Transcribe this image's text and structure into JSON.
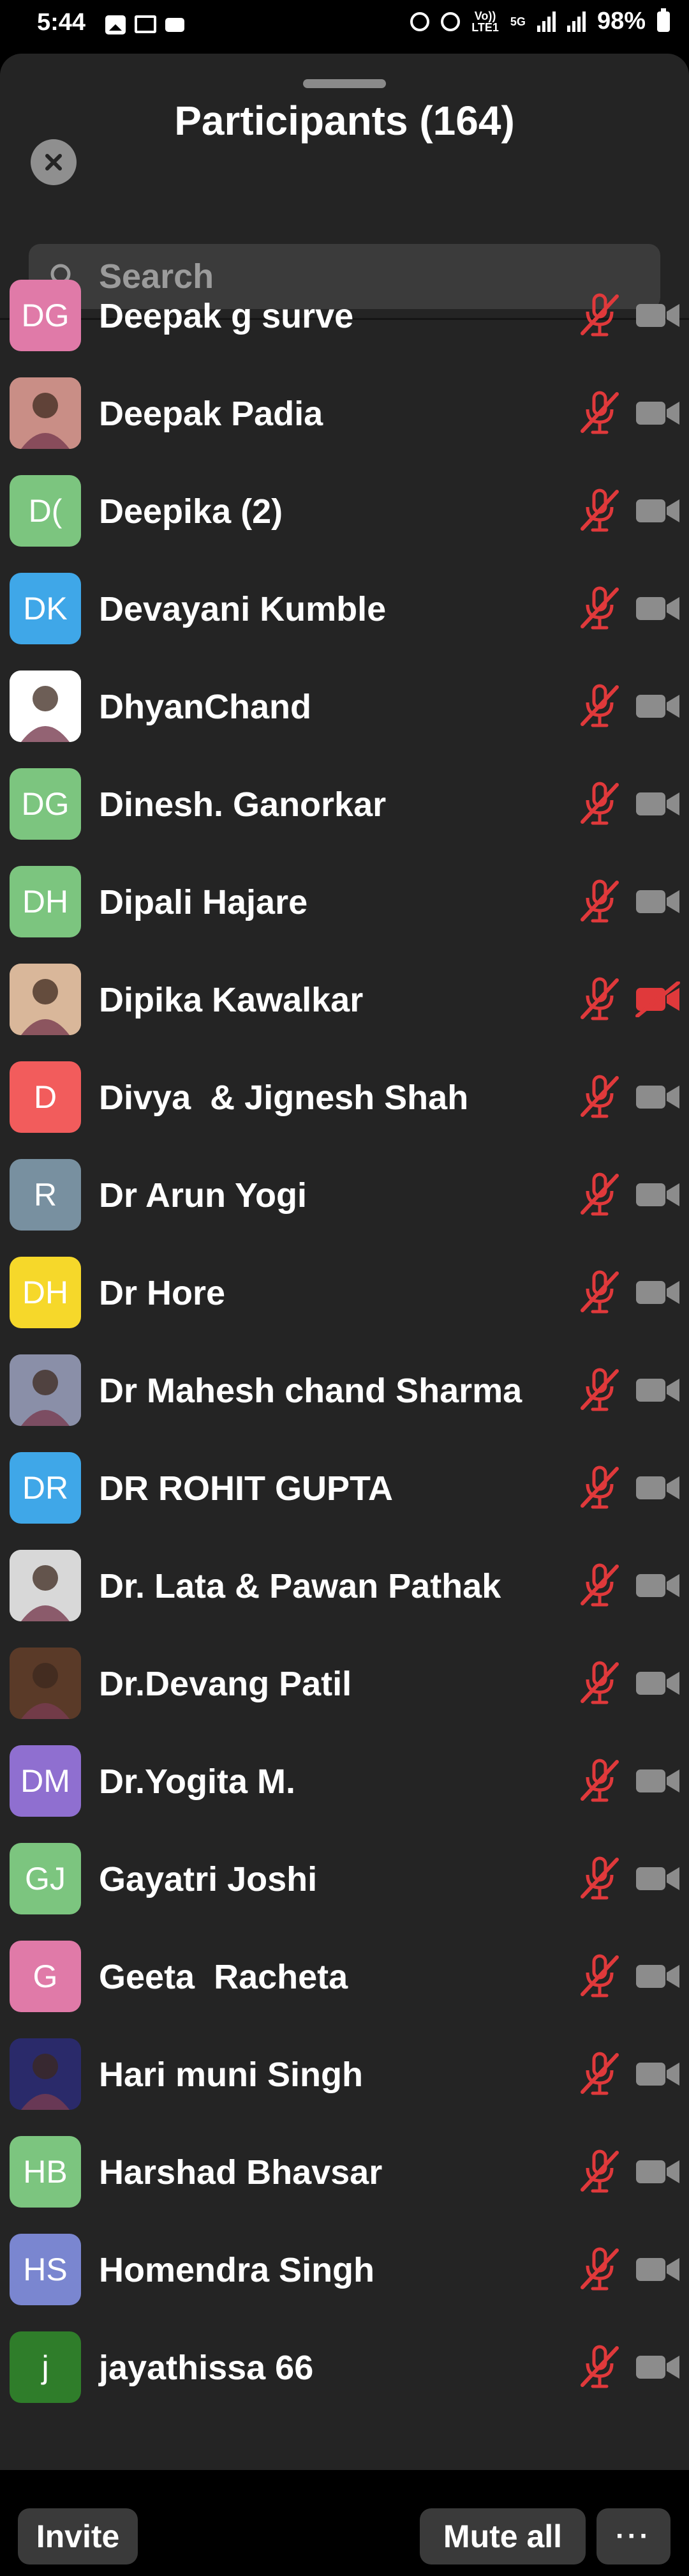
{
  "status_bar": {
    "time": "5:44",
    "network_labels": [
      "Vo))",
      "LTE1",
      "5G"
    ],
    "battery": "98%"
  },
  "header": {
    "title": "Participants (164)"
  },
  "search": {
    "placeholder": "Search"
  },
  "participants": [
    {
      "name": "Deepak g surve",
      "initials": "DG",
      "avatar_color": "#e07aa8",
      "photo": false,
      "mic_muted": true,
      "video_off": false
    },
    {
      "name": "Deepak Padia",
      "initials": "",
      "avatar_color": "#c98e86",
      "photo": true,
      "mic_muted": true,
      "video_off": false
    },
    {
      "name": "Deepika (2)",
      "initials": "D(",
      "avatar_color": "#7cc57f",
      "photo": false,
      "mic_muted": true,
      "video_off": false
    },
    {
      "name": "Devayani Kumble",
      "initials": "DK",
      "avatar_color": "#3fa7e8",
      "photo": false,
      "mic_muted": true,
      "video_off": false
    },
    {
      "name": "DhyanChand",
      "initials": "",
      "avatar_color": "#ffffff",
      "photo": true,
      "mic_muted": true,
      "video_off": false
    },
    {
      "name": "Dinesh. Ganorkar",
      "initials": "DG",
      "avatar_color": "#7cc57f",
      "photo": false,
      "mic_muted": true,
      "video_off": false
    },
    {
      "name": "Dipali Hajare",
      "initials": "DH",
      "avatar_color": "#7cc57f",
      "photo": false,
      "mic_muted": true,
      "video_off": false
    },
    {
      "name": "Dipika Kawalkar",
      "initials": "",
      "avatar_color": "#d9b79a",
      "photo": true,
      "mic_muted": true,
      "video_off": true
    },
    {
      "name": "Divya  & Jignesh Shah",
      "initials": "D",
      "avatar_color": "#f25c5c",
      "photo": false,
      "mic_muted": true,
      "video_off": false
    },
    {
      "name": "Dr Arun Yogi",
      "initials": "R",
      "avatar_color": "#7890a0",
      "photo": false,
      "mic_muted": true,
      "video_off": false
    },
    {
      "name": "Dr Hore",
      "initials": "DH",
      "avatar_color": "#f6d82a",
      "photo": false,
      "mic_muted": true,
      "video_off": false
    },
    {
      "name": "Dr Mahesh chand Sharma",
      "initials": "",
      "avatar_color": "#8a8fa8",
      "photo": true,
      "mic_muted": true,
      "video_off": false
    },
    {
      "name": "DR ROHIT GUPTA",
      "initials": "DR",
      "avatar_color": "#3fa7e8",
      "photo": false,
      "mic_muted": true,
      "video_off": false
    },
    {
      "name": "Dr. Lata & Pawan Pathak",
      "initials": "",
      "avatar_color": "#d8d8d8",
      "photo": true,
      "mic_muted": true,
      "video_off": false
    },
    {
      "name": "Dr.Devang Patil",
      "initials": "",
      "avatar_color": "#5a3a28",
      "photo": true,
      "mic_muted": true,
      "video_off": false
    },
    {
      "name": "Dr.Yogita M.",
      "initials": "DM",
      "avatar_color": "#8f6fd0",
      "photo": false,
      "mic_muted": true,
      "video_off": false
    },
    {
      "name": "Gayatri Joshi",
      "initials": "GJ",
      "avatar_color": "#7cc57f",
      "photo": false,
      "mic_muted": true,
      "video_off": false
    },
    {
      "name": "Geeta  Racheta",
      "initials": "G",
      "avatar_color": "#e07aa8",
      "photo": false,
      "mic_muted": true,
      "video_off": false
    },
    {
      "name": "Hari muni Singh",
      "initials": "",
      "avatar_color": "#2a2a6a",
      "photo": true,
      "mic_muted": true,
      "video_off": false
    },
    {
      "name": "Harshad Bhavsar",
      "initials": "HB",
      "avatar_color": "#7cc57f",
      "photo": false,
      "mic_muted": true,
      "video_off": false
    },
    {
      "name": "Homendra Singh",
      "initials": "HS",
      "avatar_color": "#7a86d0",
      "photo": false,
      "mic_muted": true,
      "video_off": false
    },
    {
      "name": "jayathissa 66",
      "initials": "j",
      "avatar_color": "#2f7d2a",
      "photo": false,
      "mic_muted": true,
      "video_off": false
    }
  ],
  "footer": {
    "invite_label": "Invite",
    "mute_all_label": "Mute all",
    "more_label": "···"
  },
  "colors": {
    "muted_red": "#e0393b",
    "camera_gray": "#8c8c8c",
    "sheet_bg": "#242424"
  }
}
